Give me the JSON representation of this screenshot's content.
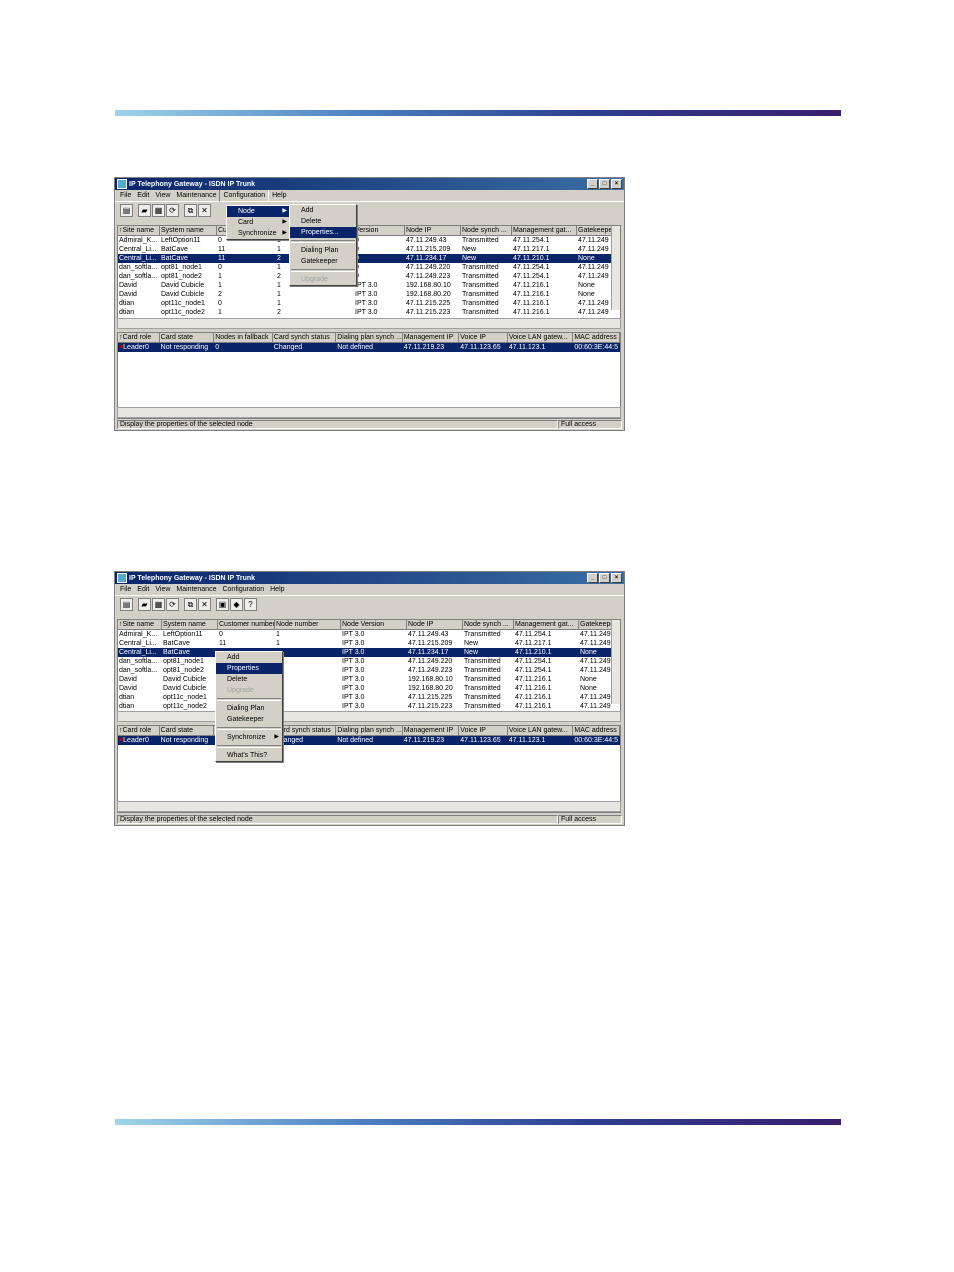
{
  "window": {
    "title": "IP Telephony Gateway - ISDN IP Trunk",
    "menus": [
      "File",
      "Edit",
      "View",
      "Maintenance",
      "Configuration",
      "Help"
    ],
    "status_text": "Display the properties of the selected node",
    "status_access": "Full access"
  },
  "node_table_top": {
    "headers": [
      "Site name",
      "System name",
      "Cu",
      "",
      "",
      "Version",
      "Node IP",
      "Node synch ...",
      "Management gat...",
      "Gatekeepe"
    ],
    "rows": [
      [
        "Admiral_K...",
        "LeftOption11",
        "0",
        "1",
        "",
        "0",
        "47.11.249.43",
        "Transmitted",
        "47.11.254.1",
        "47.11.249"
      ],
      [
        "Central_Li...",
        "BatCave",
        "11",
        "1",
        "",
        "0",
        "47.11.215.209",
        "New",
        "47.11.217.1",
        "47.11.249"
      ],
      [
        "Central_Li...",
        "BatCave",
        "11",
        "2",
        "",
        "0",
        "47.11.234.17",
        "New",
        "47.11.210.1",
        "None"
      ],
      [
        "dan_softla...",
        "opt81_node1",
        "0",
        "1",
        "",
        "0",
        "47.11.249.220",
        "Transmitted",
        "47.11.254.1",
        "47.11.249"
      ],
      [
        "dan_softla...",
        "opt81_node2",
        "1",
        "2",
        "",
        "0",
        "47.11.249.223",
        "Transmitted",
        "47.11.254.1",
        "47.11.249"
      ],
      [
        "David",
        "David Cubicle",
        "1",
        "1",
        "",
        "IPT 3.0",
        "192.168.80.10",
        "Transmitted",
        "47.11.216.1",
        "None"
      ],
      [
        "David",
        "David Cubicle",
        "2",
        "1",
        "",
        "IPT 3.0",
        "192.168.80.20",
        "Transmitted",
        "47.11.216.1",
        "None"
      ],
      [
        "dtian",
        "opt11c_node1",
        "0",
        "1",
        "",
        "IPT 3.0",
        "47.11.215.225",
        "Transmitted",
        "47.11.216.1",
        "47.11.249"
      ],
      [
        "dtian",
        "opt11c_node2",
        "1",
        "2",
        "",
        "IPT 3.0",
        "47.11.215.223",
        "Transmitted",
        "47.11.216.1",
        "47.11.249"
      ]
    ]
  },
  "node_table_bottom": {
    "headers": [
      "Site name",
      "System name",
      "Customer number",
      "Node number",
      "Node Version",
      "Node IP",
      "Node synch ...",
      "Management gat...",
      "Gatekeepe"
    ],
    "rows": [
      [
        "Admiral_K...",
        "LeftOption11",
        "0",
        "1",
        "IPT 3.0",
        "47.11.249.43",
        "Transmitted",
        "47.11.254.1",
        "47.11.249"
      ],
      [
        "Central_Li...",
        "BatCave",
        "11",
        "1",
        "IPT 3.0",
        "47.11.215.209",
        "New",
        "47.11.217.1",
        "47.11.249"
      ],
      [
        "Central_Li...",
        "BatCave",
        "",
        "",
        "IPT 3.0",
        "47.11.234.17",
        "New",
        "47.11.210.1",
        "None"
      ],
      [
        "dan_softla...",
        "opt81_node1",
        "",
        "",
        "IPT 3.0",
        "47.11.249.220",
        "Transmitted",
        "47.11.254.1",
        "47.11.249"
      ],
      [
        "dan_softla...",
        "opt81_node2",
        "",
        "",
        "IPT 3.0",
        "47.11.249.223",
        "Transmitted",
        "47.11.254.1",
        "47.11.249"
      ],
      [
        "David",
        "David Cubicle",
        "",
        "",
        "IPT 3.0",
        "192.168.80.10",
        "Transmitted",
        "47.11.216.1",
        "None"
      ],
      [
        "David",
        "David Cubicle",
        "",
        "",
        "IPT 3.0",
        "192.168.80.20",
        "Transmitted",
        "47.11.216.1",
        "None"
      ],
      [
        "dtian",
        "opt11c_node1",
        "",
        "",
        "IPT 3.0",
        "47.11.215.225",
        "Transmitted",
        "47.11.216.1",
        "47.11.249"
      ],
      [
        "dtian",
        "opt11c_node2",
        "",
        "",
        "IPT 3.0",
        "47.11.215.223",
        "Transmitted",
        "47.11.216.1",
        "47.11.249"
      ]
    ]
  },
  "card_table_top": {
    "headers": [
      "Card role",
      "Card state",
      "Nodes in fallback",
      "Card synch status",
      "Dialing plan synch ...",
      "Management IP",
      "Voice IP",
      "Voice LAN gatew...",
      "MAC address"
    ],
    "row": [
      "Leader0",
      "Not responding",
      "0",
      "Changed",
      "Not defined",
      "47.11.219.23",
      "47.11.123.65",
      "47.11.123.1",
      "00:60:3E:44:5"
    ]
  },
  "card_table_bottom": {
    "headers": [
      "Card role",
      "Card state",
      "",
      "ard synch status",
      "Dialing plan synch ...",
      "Management IP",
      "Voice IP",
      "Voice LAN gatew...",
      "MAC address"
    ],
    "row": [
      "Leader0",
      "Not responding",
      "",
      "hanged",
      "Not defined",
      "47.11.219.23",
      "47.11.123.65",
      "47.11.123.1",
      "00:60:3E:44:5"
    ]
  },
  "config_menu": {
    "items": [
      "Node",
      "Card",
      "Synchronize"
    ]
  },
  "node_submenu": {
    "items": [
      "Add",
      "Delete",
      "Properties...",
      "Dialing Plan",
      "Gatekeeper",
      "Upgrade"
    ]
  },
  "context_menu": {
    "items": [
      "Add",
      "Properties",
      "Delete",
      "Upgrade",
      "Dialing Plan",
      "Gatekeeper",
      "Synchronize",
      "What's This?"
    ]
  },
  "colors": {
    "selection": "#0a246a",
    "titlebar": "#0a246a",
    "window_face": "#d4d0c8"
  }
}
